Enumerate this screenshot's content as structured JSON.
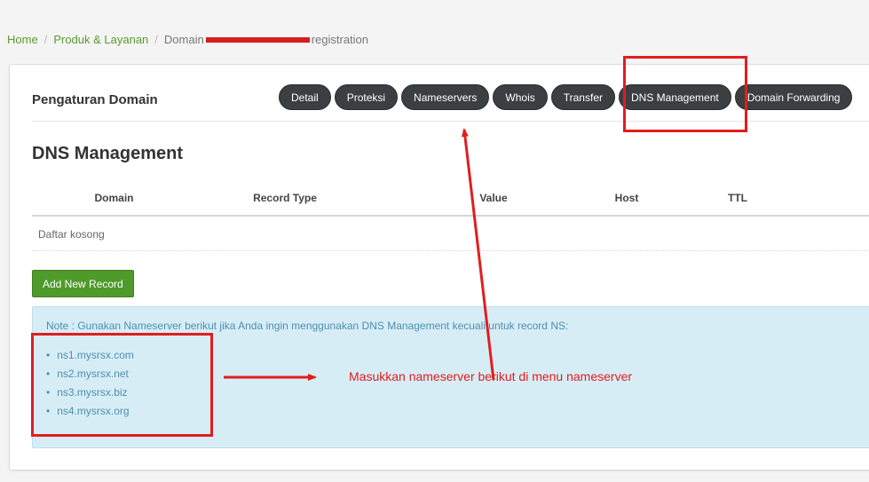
{
  "breadcrumb": {
    "home": "Home",
    "products": "Produk & Layanan",
    "current_prefix": "Domain",
    "current_suffix": "registration"
  },
  "panel": {
    "title": "Pengaturan Domain",
    "tabs": [
      "Detail",
      "Proteksi",
      "Nameservers",
      "Whois",
      "Transfer",
      "DNS Management",
      "Domain Forwarding"
    ]
  },
  "dns": {
    "title": "DNS Management",
    "columns": [
      "Domain",
      "Record Type",
      "Value",
      "Host",
      "TTL"
    ],
    "empty_text": "Daftar kosong",
    "add_button": "Add New Record"
  },
  "note": {
    "text": "Note : Gunakan Nameserver berikut jika Anda ingin menggunakan DNS Management kecuali untuk record NS:",
    "nameservers": [
      "ns1.mysrsx.com",
      "ns2.mysrsx.net",
      "ns3.mysrsx.biz",
      "ns4.mysrsx.org"
    ]
  },
  "annotation": {
    "text": "Masukkan nameserver berikut di menu nameserver"
  },
  "colors": {
    "accent_green": "#4e9a2a",
    "tab_dark": "#3b3f42",
    "note_bg": "#d7edf6",
    "annotation_red": "#e01e1e"
  }
}
